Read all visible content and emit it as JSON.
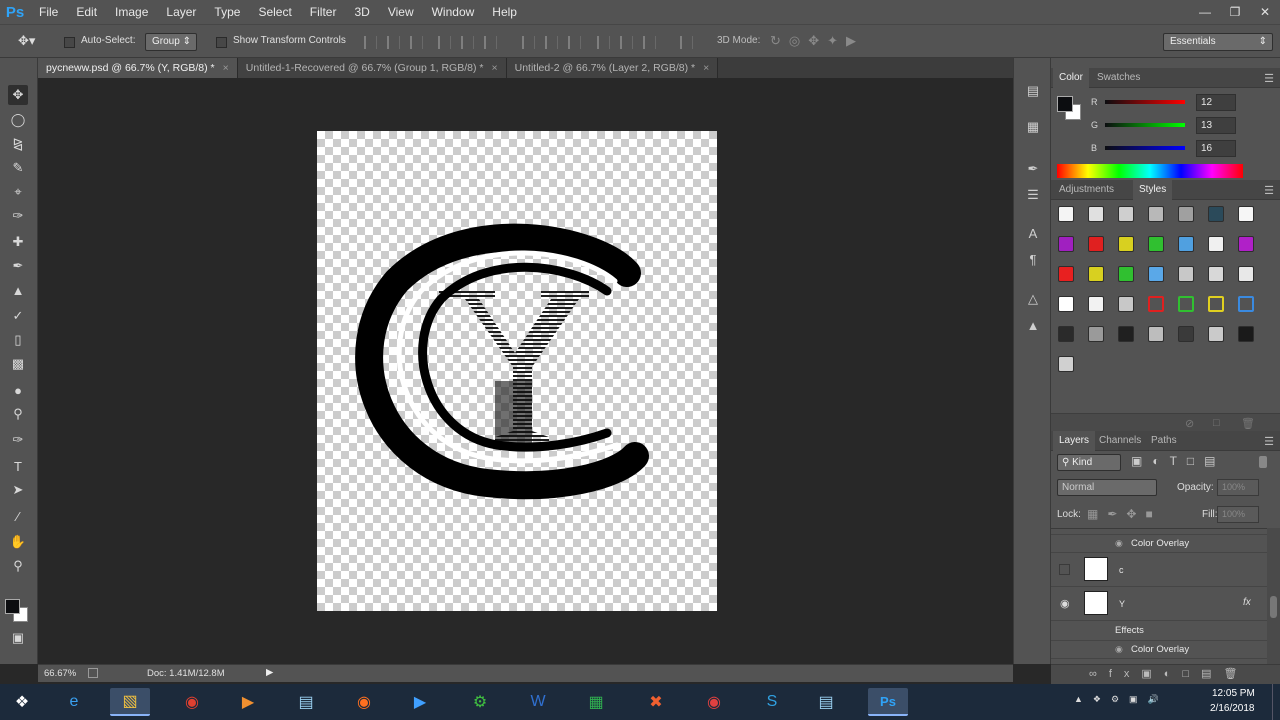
{
  "app": {
    "logo": "Ps"
  },
  "menubar": {
    "items": [
      "File",
      "Edit",
      "Image",
      "Layer",
      "Type",
      "Select",
      "Filter",
      "3D",
      "View",
      "Window",
      "Help"
    ]
  },
  "options": {
    "auto_select_label": "Auto-Select:",
    "auto_select_value": "Group",
    "show_transform_label": "Show Transform Controls",
    "mode_3d_label": "3D Mode:",
    "workspace": "Essentials"
  },
  "tabs": [
    {
      "label": "pycneww.psd @ 66.7% (Y, RGB/8) *"
    },
    {
      "label": "Untitled-1-Recovered @ 66.7% (Group 1, RGB/8) *"
    },
    {
      "label": "Untitled-2 @ 66.7% (Layer 2, RGB/8) *"
    }
  ],
  "status": {
    "zoom": "66.67%",
    "doc": "Doc: 1.41M/12.8M"
  },
  "color_panel": {
    "tabs": [
      "Color",
      "Swatches"
    ],
    "channels": [
      {
        "label": "R",
        "value": "12",
        "color": "#e02020"
      },
      {
        "label": "G",
        "value": "13",
        "color": "#20c020"
      },
      {
        "label": "B",
        "value": "16",
        "color": "#2050e0"
      }
    ]
  },
  "styles_panel": {
    "tabs": [
      "Adjustments",
      "Styles"
    ]
  },
  "layers_panel": {
    "tabs": [
      "Layers",
      "Channels",
      "Paths"
    ],
    "filter": "Kind",
    "blend_mode": "Normal",
    "opacity_label": "Opacity:",
    "opacity_value": "100%",
    "lock_label": "Lock:",
    "fill_label": "Fill:",
    "fill_value": "100%",
    "rows": [
      {
        "type": "effect",
        "label": "Color Overlay"
      },
      {
        "type": "layer",
        "label": "c"
      },
      {
        "type": "layer",
        "label": "Y"
      },
      {
        "type": "effects",
        "label": "Effects"
      },
      {
        "type": "effect",
        "label": "Color Overlay"
      }
    ]
  },
  "taskbar": {
    "time": "12:05 PM",
    "date": "2/16/2018"
  }
}
